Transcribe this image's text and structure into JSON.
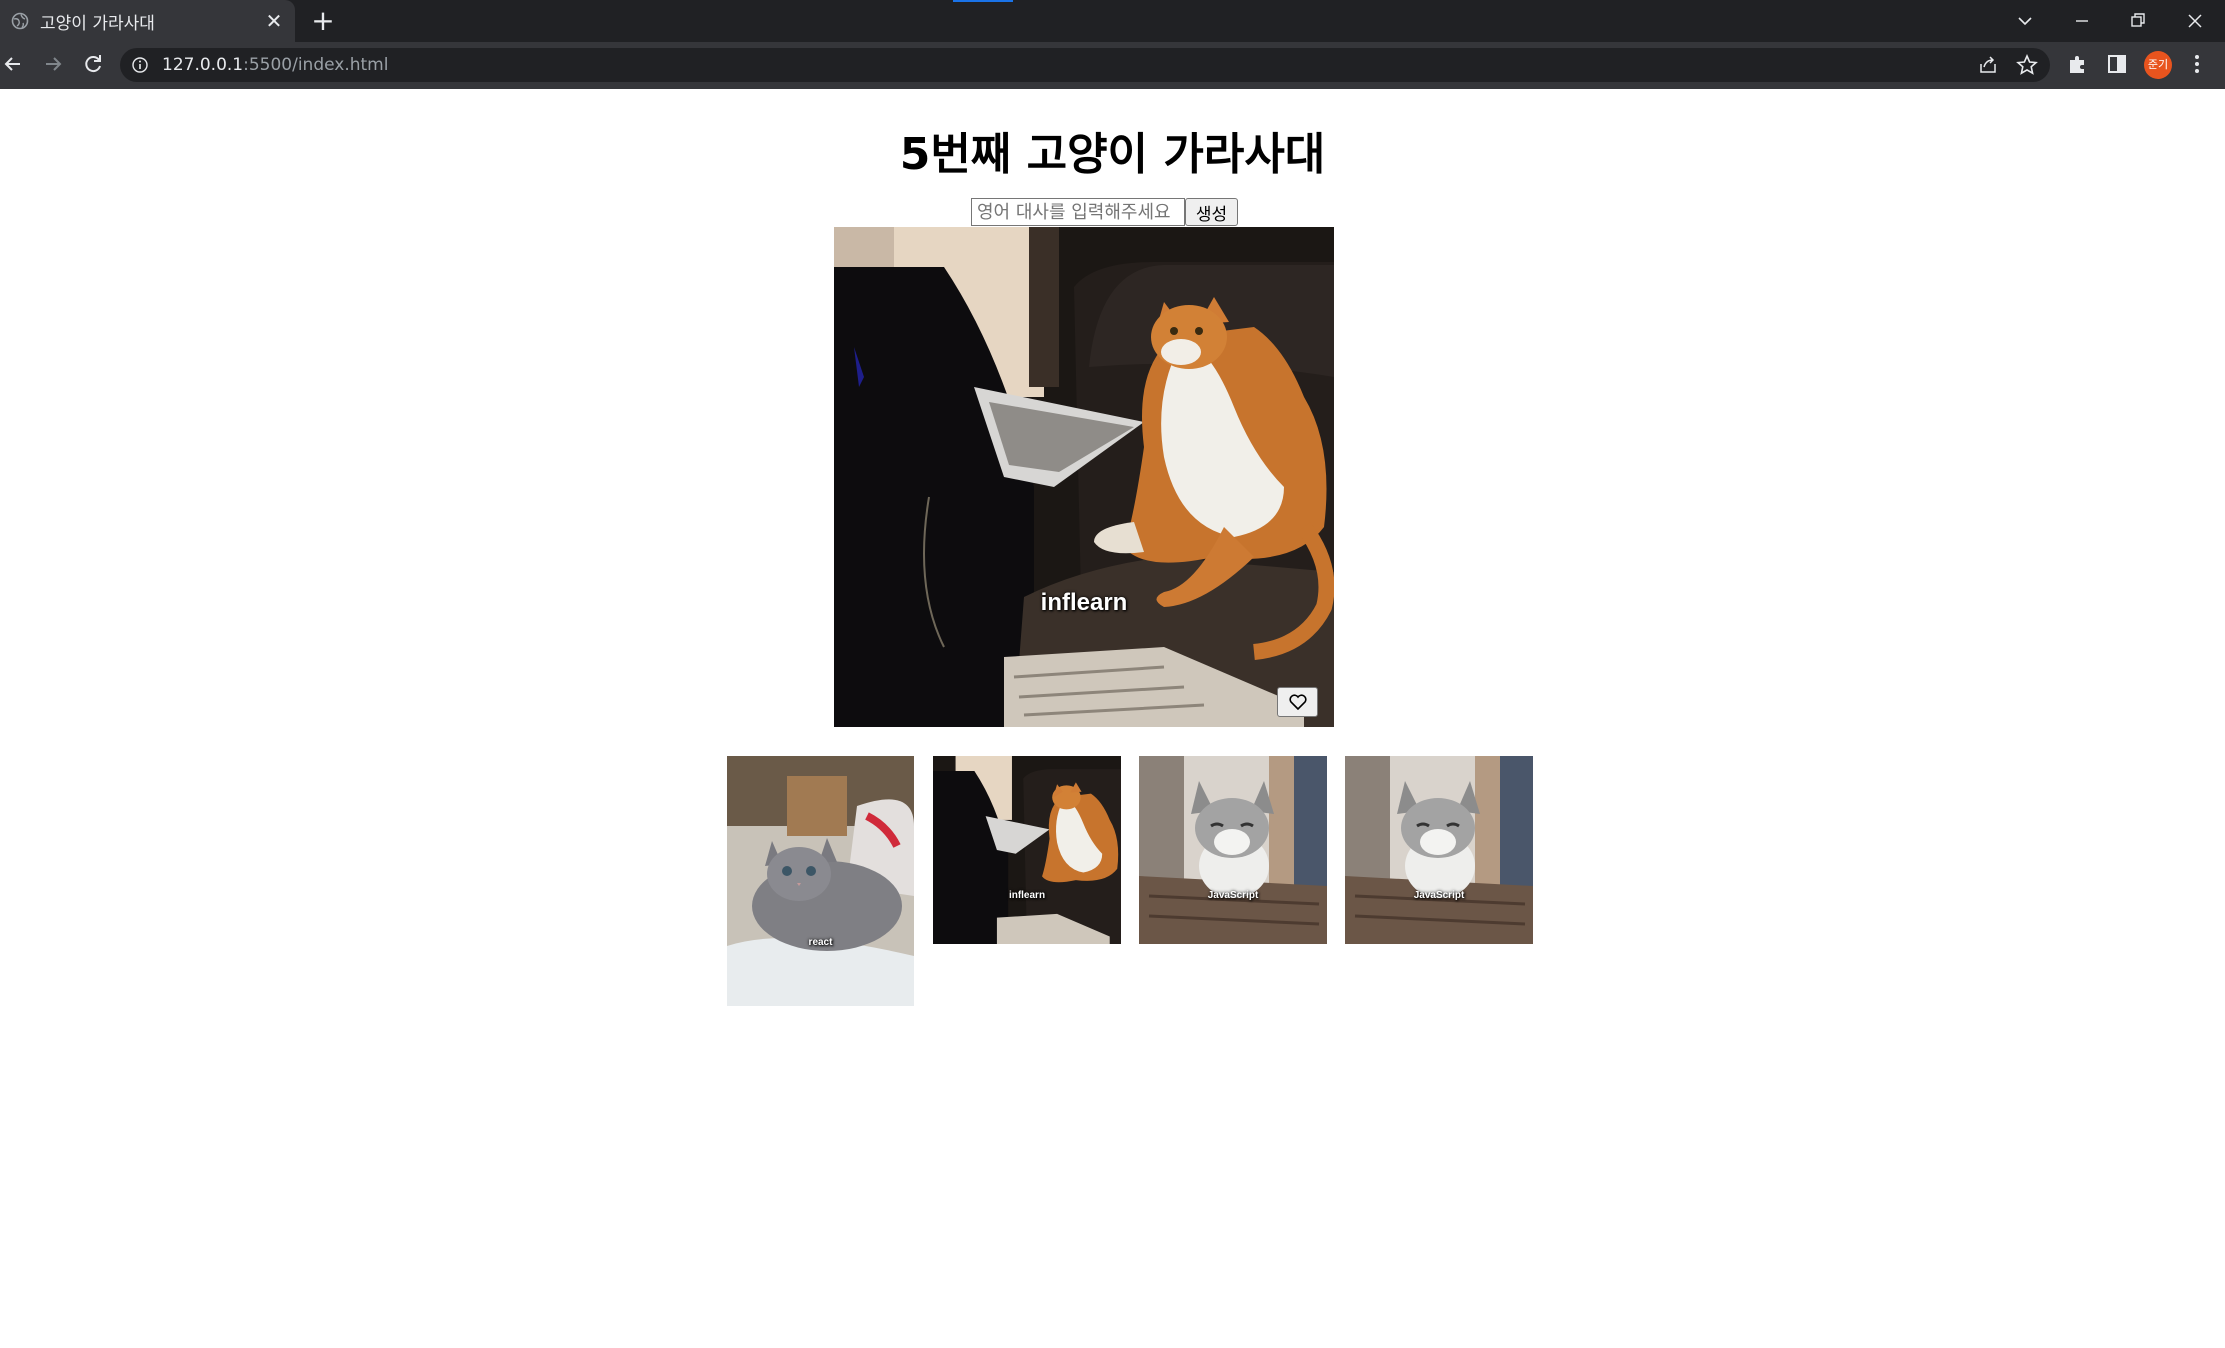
{
  "browser": {
    "tab_title": "고양이 가라사대",
    "url_host": "127.0.0.1",
    "url_rest": ":5500/index.html",
    "profile_initials": "준기"
  },
  "page": {
    "title": "5번째 고양이 가라사대",
    "input_placeholder": "영어 대사를 입력해주세요",
    "input_value": "",
    "generate_label": "생성",
    "main_caption": "inflearn"
  },
  "favorites": [
    {
      "caption": "react",
      "scene": "gray-kitten"
    },
    {
      "caption": "inflearn",
      "scene": "orange-cat-laptop"
    },
    {
      "caption": "JavaScript",
      "scene": "kitten-cat-tree"
    },
    {
      "caption": "JavaScript",
      "scene": "kitten-cat-tree"
    }
  ],
  "icons": {
    "tab": "globe-icon",
    "like": "heart-icon"
  },
  "colors": {
    "chrome_dark": "#202124",
    "chrome_tab": "#35363a",
    "accent": "#1a73e8",
    "avatar": "#e8541e"
  }
}
